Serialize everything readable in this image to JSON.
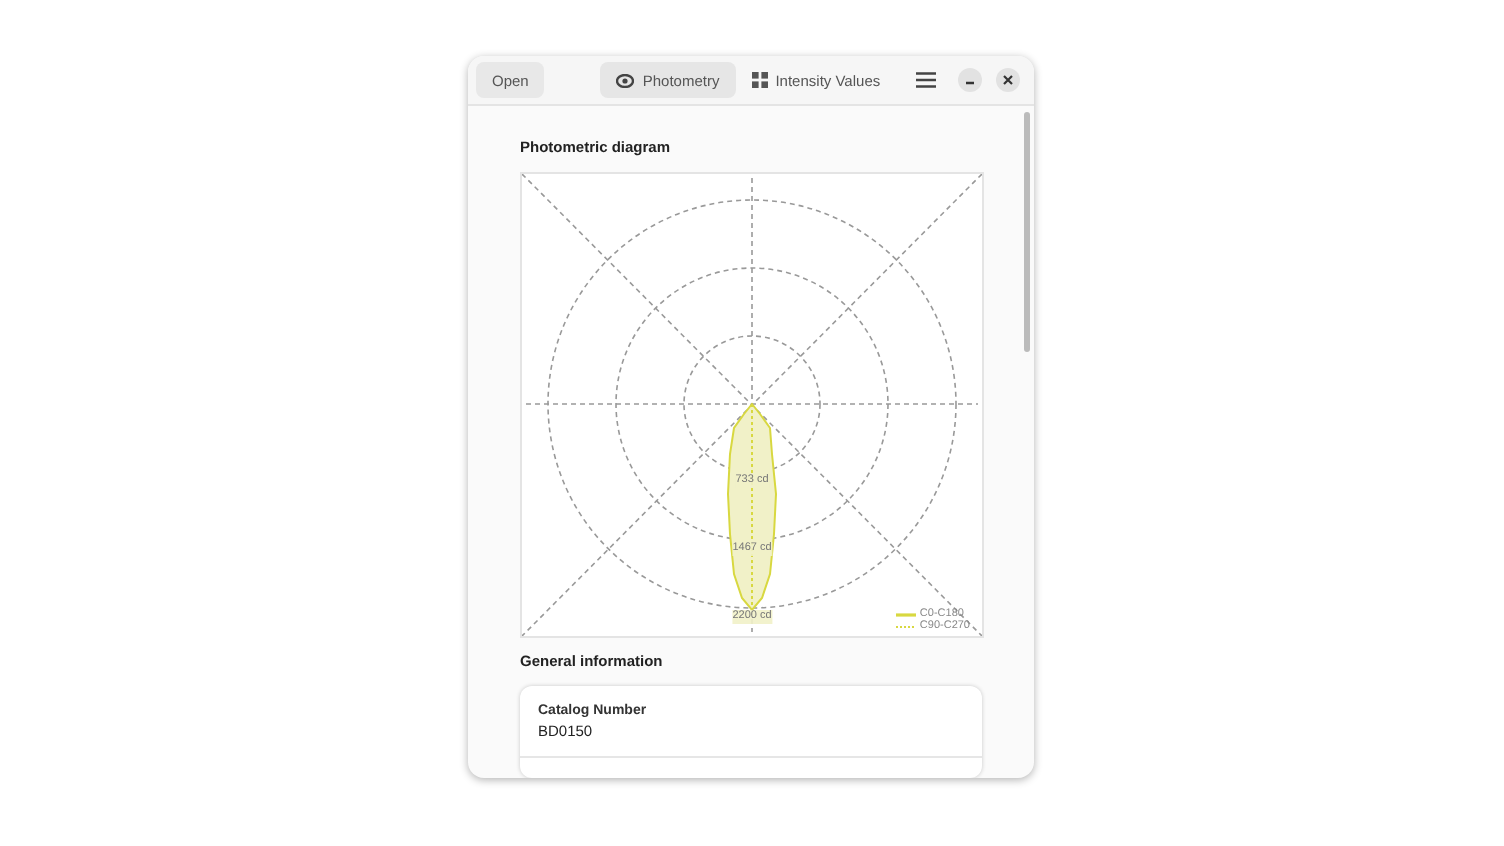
{
  "header": {
    "open_button": "Open",
    "tabs": [
      {
        "label": "Photometry",
        "selected": true
      },
      {
        "label": "Intensity Values",
        "selected": false
      }
    ]
  },
  "diagram": {
    "title": "Photometric diagram",
    "ring_labels": [
      "733 cd",
      "1467 cd",
      "2200 cd"
    ],
    "legend": [
      {
        "label": "C0-C180",
        "kind": "solid"
      },
      {
        "label": "C90-C270",
        "kind": "dotted"
      }
    ]
  },
  "general": {
    "title": "General information",
    "fields": [
      {
        "label": "Catalog Number",
        "value": "BD0150"
      }
    ]
  }
}
